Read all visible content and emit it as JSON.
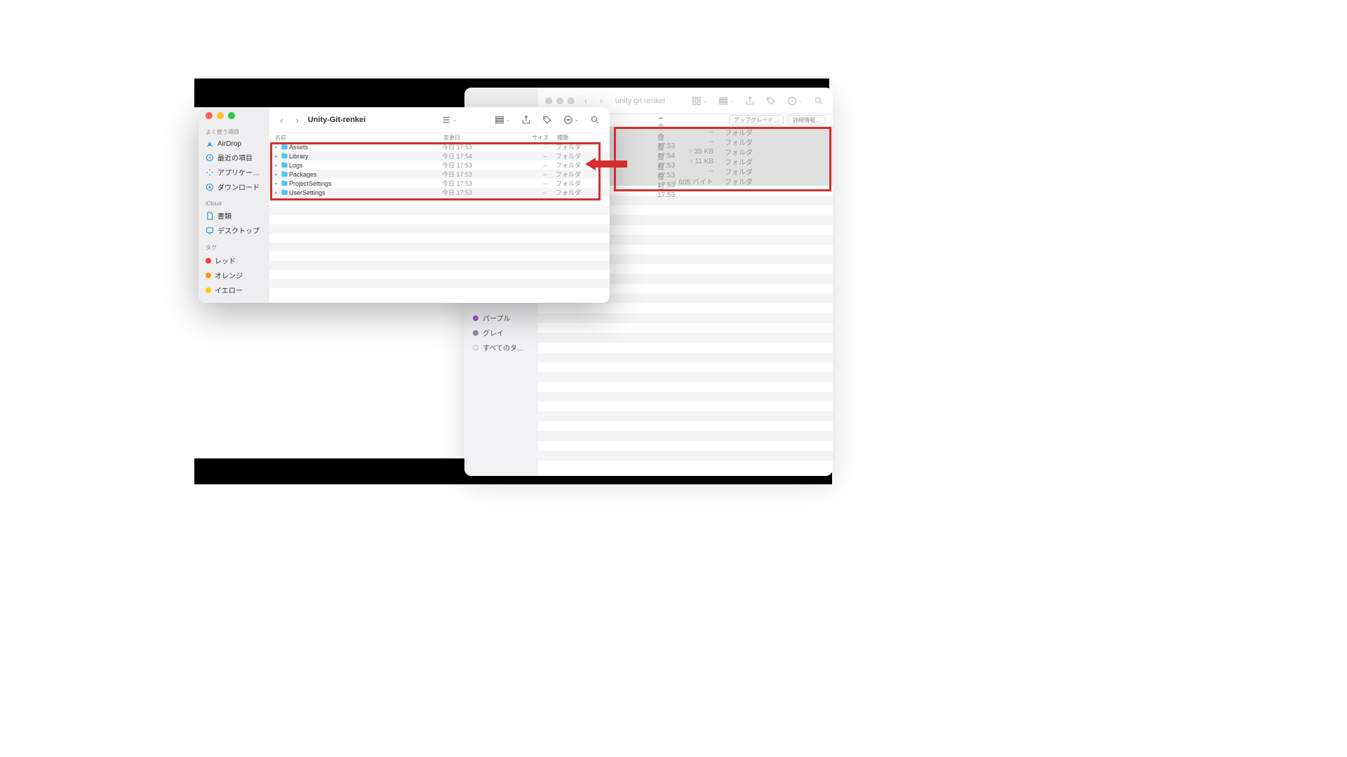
{
  "back_window": {
    "title": "unity git renkei",
    "upgrade_btn": "アップグレード…",
    "detail_btn": "詳細情報…",
    "sidebar_tags": {
      "purple": "パープル",
      "gray": "グレイ",
      "all": "すべてのタ…"
    },
    "rows": [
      {
        "cloud": "☁",
        "date": "今日 17:53",
        "size": "--",
        "kind": "フォルダ"
      },
      {
        "cloud": "☁",
        "date": "今日 17:54",
        "size": "--",
        "kind": "フォルダ"
      },
      {
        "cloud": "○",
        "date": "今日 17:53",
        "size": "↑ 35 KB",
        "kind": "フォルダ"
      },
      {
        "cloud": "☁",
        "date": "今日 17:53",
        "size": "↑ 11 KB",
        "kind": "フォルダ"
      },
      {
        "cloud": "☁",
        "date": "今日 17:53",
        "size": "--",
        "kind": "フォルダ"
      },
      {
        "cloud": "○",
        "date": "今日 17:53",
        "size": "↑ 605 バイト",
        "kind": "フォルダ"
      }
    ]
  },
  "front_window": {
    "title": "Unity-Git-renkei",
    "sidebar": {
      "favorites_label": "よく使う項目",
      "items": [
        {
          "icon": "airdrop",
          "label": "AirDrop"
        },
        {
          "icon": "clock",
          "label": "最近の項目"
        },
        {
          "icon": "apps",
          "label": "アプリケー…"
        },
        {
          "icon": "download",
          "label": "ダウンロード"
        }
      ],
      "icloud_label": "iCloud",
      "icloud_items": [
        {
          "icon": "doc",
          "label": "書類"
        },
        {
          "icon": "desktop",
          "label": "デスクトップ"
        }
      ],
      "tags_label": "タグ",
      "tags": [
        {
          "color": "#ff3b30",
          "label": "レッド"
        },
        {
          "color": "#ff9500",
          "label": "オレンジ"
        },
        {
          "color": "#ffcc00",
          "label": "イエロー"
        }
      ]
    },
    "columns": {
      "name": "名前",
      "date": "変更日",
      "size": "サイズ",
      "kind": "種類"
    },
    "rows": [
      {
        "name": "Assets",
        "date": "今日 17:53",
        "size": "--",
        "kind": "フォルダ"
      },
      {
        "name": "Library",
        "date": "今日 17:54",
        "size": "--",
        "kind": "フォルダ"
      },
      {
        "name": "Logs",
        "date": "今日 17:53",
        "size": "--",
        "kind": "フォルダ"
      },
      {
        "name": "Packages",
        "date": "今日 17:53",
        "size": "--",
        "kind": "フォルダ"
      },
      {
        "name": "ProjectSettings",
        "date": "今日 17:53",
        "size": "--",
        "kind": "フォルダ"
      },
      {
        "name": "UserSettings",
        "date": "今日 17:53",
        "size": "--",
        "kind": "フォルダ"
      }
    ]
  }
}
